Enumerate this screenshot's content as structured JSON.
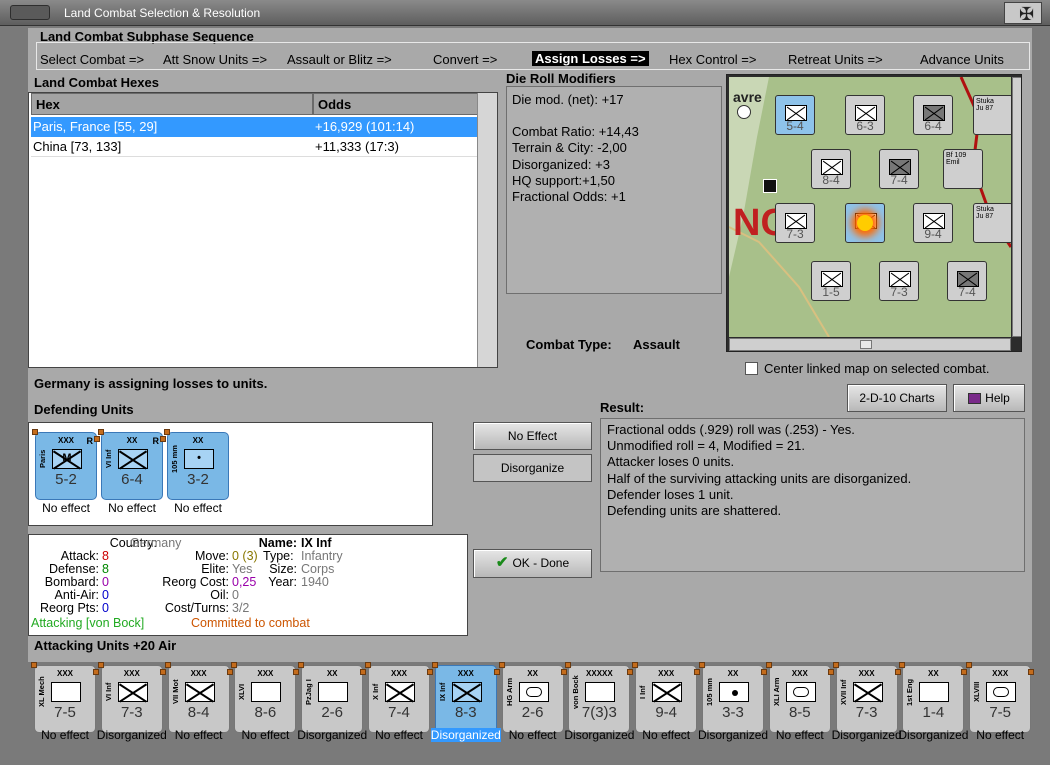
{
  "window": {
    "title": "Land Combat Selection & Resolution"
  },
  "subphase": {
    "heading": "Land Combat Subphase Sequence",
    "steps": [
      "Select Combat =>",
      "Att Snow Units =>",
      "Assault or Blitz =>",
      "Convert =>",
      "Assign Losses =>",
      "Hex Control =>",
      "Retreat Units =>",
      "Advance Units"
    ],
    "selected_index": 4
  },
  "combat_hexes": {
    "heading": "Land Combat Hexes",
    "columns": [
      "Hex",
      "Odds"
    ],
    "rows": [
      {
        "hex": "Paris, France [55, 29]",
        "odds": "+16,929 (101:14)"
      },
      {
        "hex": "China [73, 133]",
        "odds": "+11,333 (17:3)"
      }
    ]
  },
  "die_roll_modifiers": {
    "heading": "Die Roll Modifiers",
    "lines": [
      "Die mod. (net): +17",
      "",
      "Combat Ratio: +14,43",
      "Terrain & City: -2,00",
      "Disorganized: +3",
      "HQ support:+1,50",
      "Fractional Odds: +1"
    ]
  },
  "combat_type": {
    "label": "Combat Type:",
    "value": "Assault"
  },
  "map": {
    "labels": [
      "avre",
      "NC"
    ],
    "tiles": [
      {
        "value": "5-4"
      },
      {
        "value": "6-3"
      },
      {
        "value": "6-4"
      },
      {
        "value": "8-4"
      },
      {
        "value": "7-4"
      },
      {
        "value": "7-3"
      },
      {
        "value": "9-4"
      },
      {
        "value": "1-5"
      },
      {
        "value": "7-3"
      },
      {
        "value": "7-4"
      }
    ],
    "air_units": [
      "Stuka",
      "Ju 87",
      "Bf 109",
      "Emil",
      "Stuka",
      "Ju 87"
    ]
  },
  "center_map": {
    "label": "Center linked map on selected combat.",
    "checked": false
  },
  "status_message": "Germany is assigning losses to units.",
  "defending": {
    "heading": "Defending Units",
    "units": [
      {
        "size": "XXX",
        "name": "Paris",
        "symbol": "M",
        "strength": "5-2",
        "status": "No effect",
        "r": "R"
      },
      {
        "size": "XX",
        "name": "VI Inf",
        "symbol": "",
        "strength": "6-4",
        "status": "No effect",
        "r": "R"
      },
      {
        "size": "XX",
        "name": "105 mm",
        "symbol": "•",
        "strength": "3-2",
        "status": "No effect",
        "r": ""
      }
    ]
  },
  "buttons": {
    "charts": "2-D-10 Charts",
    "help": "Help",
    "no_effect": "No Effect",
    "disorganize": "Disorganize",
    "ok_done": "OK - Done"
  },
  "result": {
    "heading": "Result:",
    "lines": [
      "Fractional odds (.929) roll was (.253)  - Yes.",
      "Unmodified roll = 4, Modified = 21.",
      "Attacker loses 0 units.",
      "Half of the surviving attacking units are disorganized.",
      "Defender loses 1 unit.",
      "Defending units are shattered."
    ]
  },
  "unit_info": {
    "country_label": "Country:",
    "country": "Germany",
    "attack_label": "Attack:",
    "attack": "8",
    "defense_label": "Defense:",
    "defense": "8",
    "bombard_label": "Bombard:",
    "bombard": "0",
    "antiair_label": "Anti-Air:",
    "antiair": "0",
    "reorg_label": "Reorg Pts:",
    "reorg": "0",
    "name_label": "Name:",
    "name": "IX Inf",
    "move_label": "Move:",
    "move": "0 (3)",
    "type_label": "Type:",
    "type": "Infantry",
    "elite_label": "Elite:",
    "elite": "Yes",
    "size_label": "Size:",
    "size": "Corps",
    "reorg_cost_label": "Reorg Cost:",
    "reorg_cost": "0,25",
    "year_label": "Year:",
    "year": "1940",
    "oil_label": "Oil:",
    "oil": "0",
    "cost_label": "Cost/Turns:",
    "cost": "3/2",
    "attacking": "Attacking [von Bock]",
    "committed": "Committed to combat"
  },
  "attacking": {
    "heading": "Attacking Units +20 Air",
    "units": [
      {
        "size": "XXX",
        "name": "XL Mech",
        "sym": "",
        "strength": "7-5",
        "status": "No effect",
        "selected": false
      },
      {
        "size": "XXX",
        "name": "VI Inf",
        "sym": "inf",
        "strength": "7-3",
        "status": "Disorganized",
        "selected": false
      },
      {
        "size": "XXX",
        "name": "VII Mot",
        "sym": "inf",
        "strength": "8-4",
        "status": "No effect",
        "selected": false
      },
      {
        "size": "XXX",
        "name": "XLVI Mech",
        "sym": "",
        "strength": "8-6",
        "status": "No effect",
        "selected": false
      },
      {
        "size": "XX",
        "name": "PzJag I",
        "sym": "",
        "strength": "2-6",
        "status": "Disorganized",
        "selected": false
      },
      {
        "size": "XXX",
        "name": "X Inf",
        "sym": "inf",
        "strength": "7-4",
        "status": "No effect",
        "selected": false
      },
      {
        "size": "XXX",
        "name": "IX Inf",
        "sym": "inf",
        "strength": "8-3",
        "status": "Disorganized",
        "selected": true
      },
      {
        "size": "XX",
        "name": "HG Arm Div",
        "sym": "oval",
        "strength": "2-6",
        "status": "No effect",
        "selected": false
      },
      {
        "size": "XXXXX",
        "name": "von Bock",
        "sym": "",
        "strength": "7(3)3",
        "status": "Disorganized",
        "selected": false
      },
      {
        "size": "XXX",
        "name": "I Inf",
        "sym": "inf",
        "strength": "9-4",
        "status": "No effect",
        "selected": false
      },
      {
        "size": "XX",
        "name": "105 mm",
        "sym": "dot",
        "strength": "3-3",
        "status": "Disorganized",
        "selected": false
      },
      {
        "size": "XXX",
        "name": "XLI Arm",
        "sym": "oval",
        "strength": "8-5",
        "status": "No effect",
        "selected": false
      },
      {
        "size": "XXX",
        "name": "XVII Inf",
        "sym": "inf",
        "strength": "7-3",
        "status": "Disorganized",
        "selected": false
      },
      {
        "size": "XX",
        "name": "1st Eng",
        "sym": "",
        "strength": "1-4",
        "status": "Disorganized",
        "selected": false
      },
      {
        "size": "XXX",
        "name": "XLVIII Arm",
        "sym": "oval",
        "strength": "7-5",
        "status": "No effect",
        "selected": false
      }
    ]
  },
  "colors": {
    "selection": "#3399ff",
    "panel": "#a9a9a9",
    "counter_german": "#c8c8c8",
    "counter_french": "#7ab8e6",
    "attack_red": "#cc0000",
    "defense_green": "#008800",
    "committed_orange": "#cc5500"
  }
}
